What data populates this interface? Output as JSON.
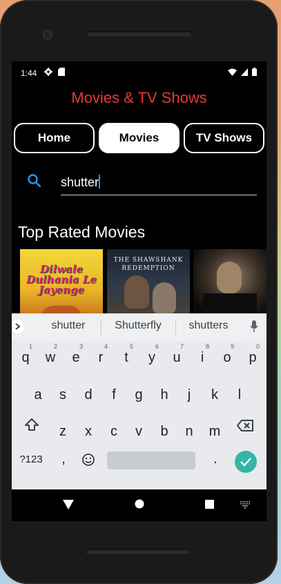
{
  "status": {
    "time": "1:44"
  },
  "app": {
    "title": "Movies & TV Shows"
  },
  "tabs": [
    {
      "label": "Home"
    },
    {
      "label": "Movies"
    },
    {
      "label": "TV Shows"
    }
  ],
  "search": {
    "value": "shutter"
  },
  "section": {
    "title": "Top Rated Movies"
  },
  "posters": [
    {
      "text": "Dilwale Dulhania Le Jayenge"
    },
    {
      "text": "THE SHAWSHANK REDEMPTION"
    },
    {
      "text": ""
    }
  ],
  "keyboard": {
    "suggestions": [
      "shutter",
      "Shutterfly",
      "shutters"
    ],
    "row1": [
      "q",
      "w",
      "e",
      "r",
      "t",
      "y",
      "u",
      "i",
      "o",
      "p"
    ],
    "row1_hints": [
      "1",
      "2",
      "3",
      "4",
      "5",
      "6",
      "7",
      "8",
      "9",
      "0"
    ],
    "row2": [
      "a",
      "s",
      "d",
      "f",
      "g",
      "h",
      "j",
      "k",
      "l"
    ],
    "row3": [
      "z",
      "x",
      "c",
      "v",
      "b",
      "n",
      "m"
    ],
    "symbols_key": "?123",
    "comma_key": ",",
    "period_key": "."
  },
  "colors": {
    "accent": "#e53935",
    "search_icon": "#2196f3",
    "enter_key": "#35b5a6"
  }
}
